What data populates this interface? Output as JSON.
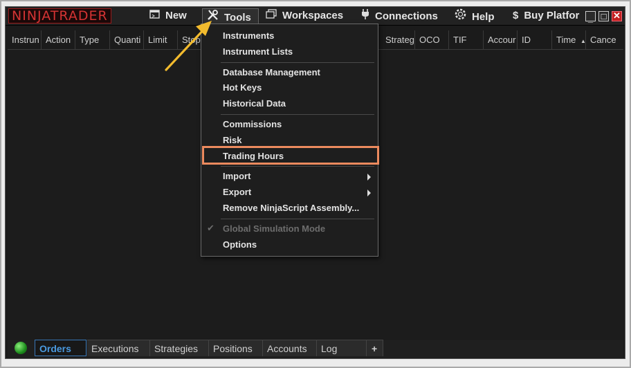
{
  "app": {
    "logo_text": "NINJATRADER",
    "brand_color": "#d43333"
  },
  "menu": {
    "new": "New",
    "tools": "Tools",
    "workspaces": "Workspaces",
    "connections": "Connections",
    "help": "Help",
    "buy": "Buy Platfor",
    "icons": [
      "new-window-icon",
      "tools-icon",
      "workspaces-icon",
      "connections-icon",
      "help-icon",
      "dollar-icon"
    ]
  },
  "window_controls": [
    "minimize",
    "maximize",
    "close"
  ],
  "columns": [
    "Instrun",
    "Action",
    "Type",
    "Quanti",
    "Limit",
    "Stop",
    "Strateg",
    "OCO",
    "TIF",
    "Accour",
    "ID",
    "Time",
    "Cance"
  ],
  "sort_indicator": "▲",
  "tools_menu": {
    "items": [
      {
        "label": "Instruments"
      },
      {
        "label": "Instrument Lists"
      },
      {
        "label": "Database Management"
      },
      {
        "label": "Hot Keys"
      },
      {
        "label": "Historical Data"
      },
      {
        "label": "Commissions"
      },
      {
        "label": "Risk"
      },
      {
        "label": "Trading Hours",
        "highlighted": true
      },
      {
        "label": "Import",
        "submenu": true
      },
      {
        "label": "Export",
        "submenu": true
      },
      {
        "label": "Remove NinjaScript Assembly..."
      },
      {
        "label": "Global Simulation Mode",
        "checked": true,
        "disabled": true
      },
      {
        "label": "Options"
      }
    ]
  },
  "tabs": {
    "items": [
      "Orders",
      "Executions",
      "Strategies",
      "Positions",
      "Accounts",
      "Log"
    ],
    "active": "Orders",
    "add": "+"
  },
  "colors": {
    "highlight": "#ec8a5e",
    "pointer_arrow": "#f2bb2e",
    "active_tab": "#4a9ae0",
    "connection_status": "#2fb52f"
  }
}
